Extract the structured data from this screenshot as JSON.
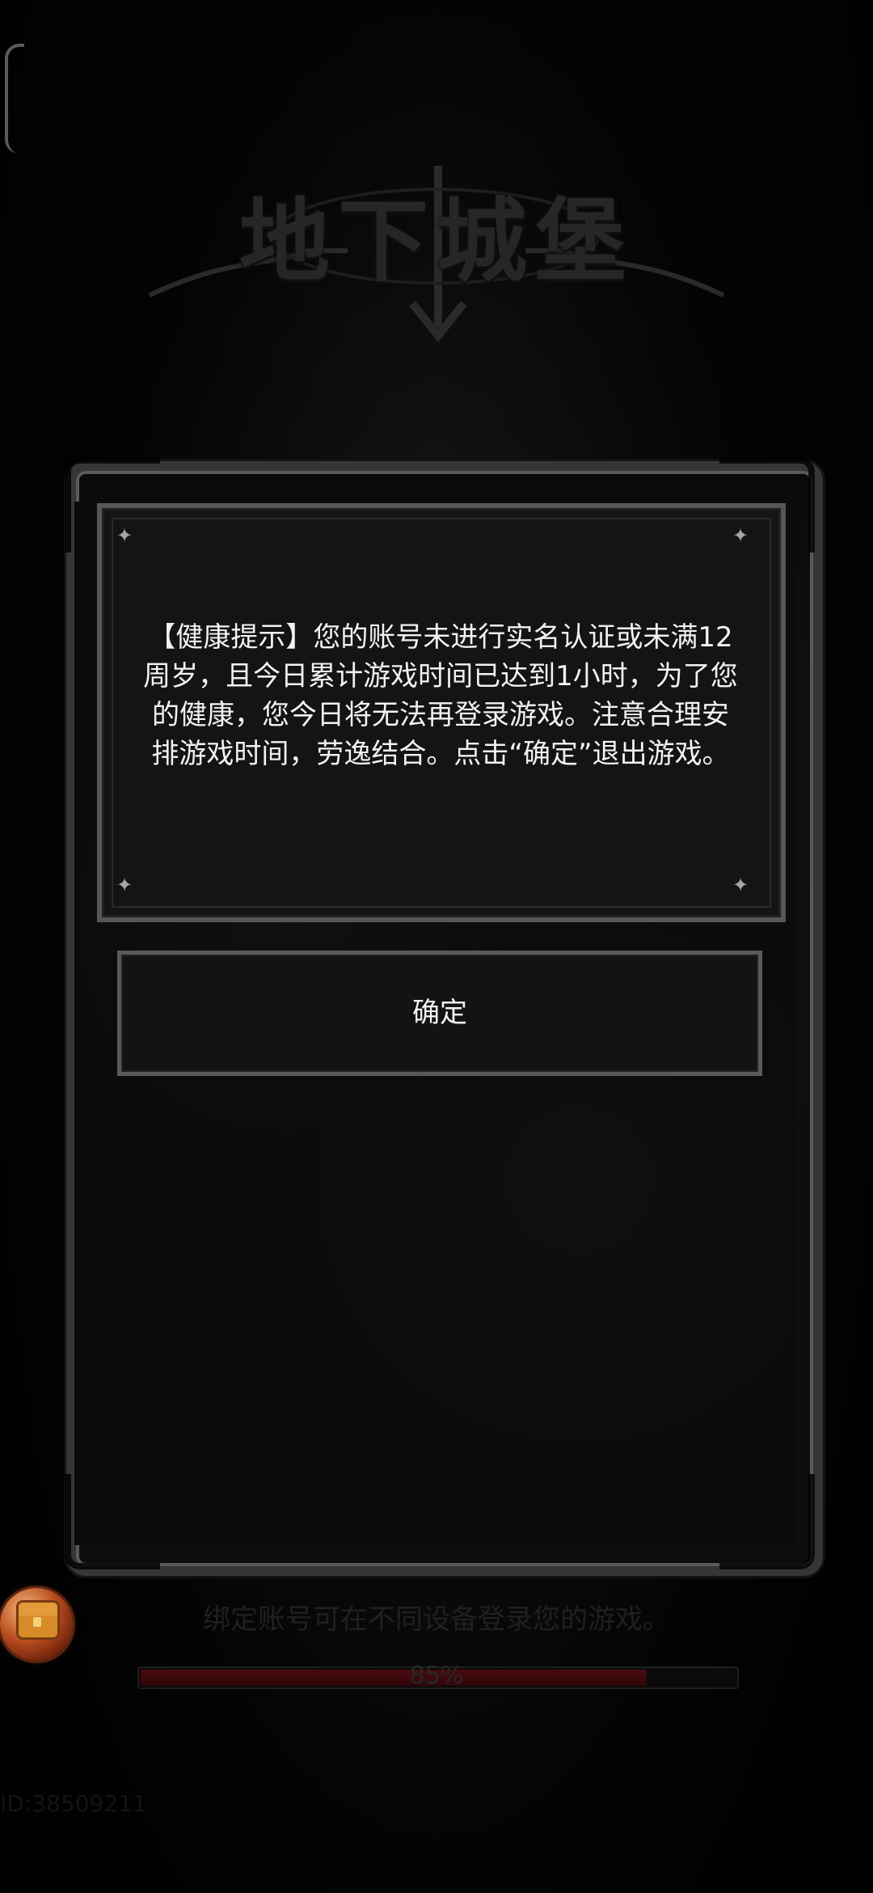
{
  "background": {
    "logo_text": "地下城堡"
  },
  "dialog": {
    "message": "【健康提示】您的账号未进行实名认证或未满12周岁，且今日累计游戏时间已达到1小时，为了您的健康，您今日将无法再登录游戏。注意合理安排游戏时间，劳逸结合。点击“确定”退出游戏。",
    "confirm_label": "确定"
  },
  "bottom": {
    "bind_tip": "绑定账号可在不同设备登录您的游戏。",
    "progress_text": "85%",
    "progress_value": 0.85,
    "id_text": "ID:38509211"
  },
  "icons": {
    "gift": "treasure-chest-icon",
    "sparkle": "sparkle-icon"
  },
  "colors": {
    "background": "#050505",
    "dialog_surface": "#141415",
    "frame": "#565656",
    "text": "#f2f2f2",
    "progress_fill": "#4a0b10"
  }
}
